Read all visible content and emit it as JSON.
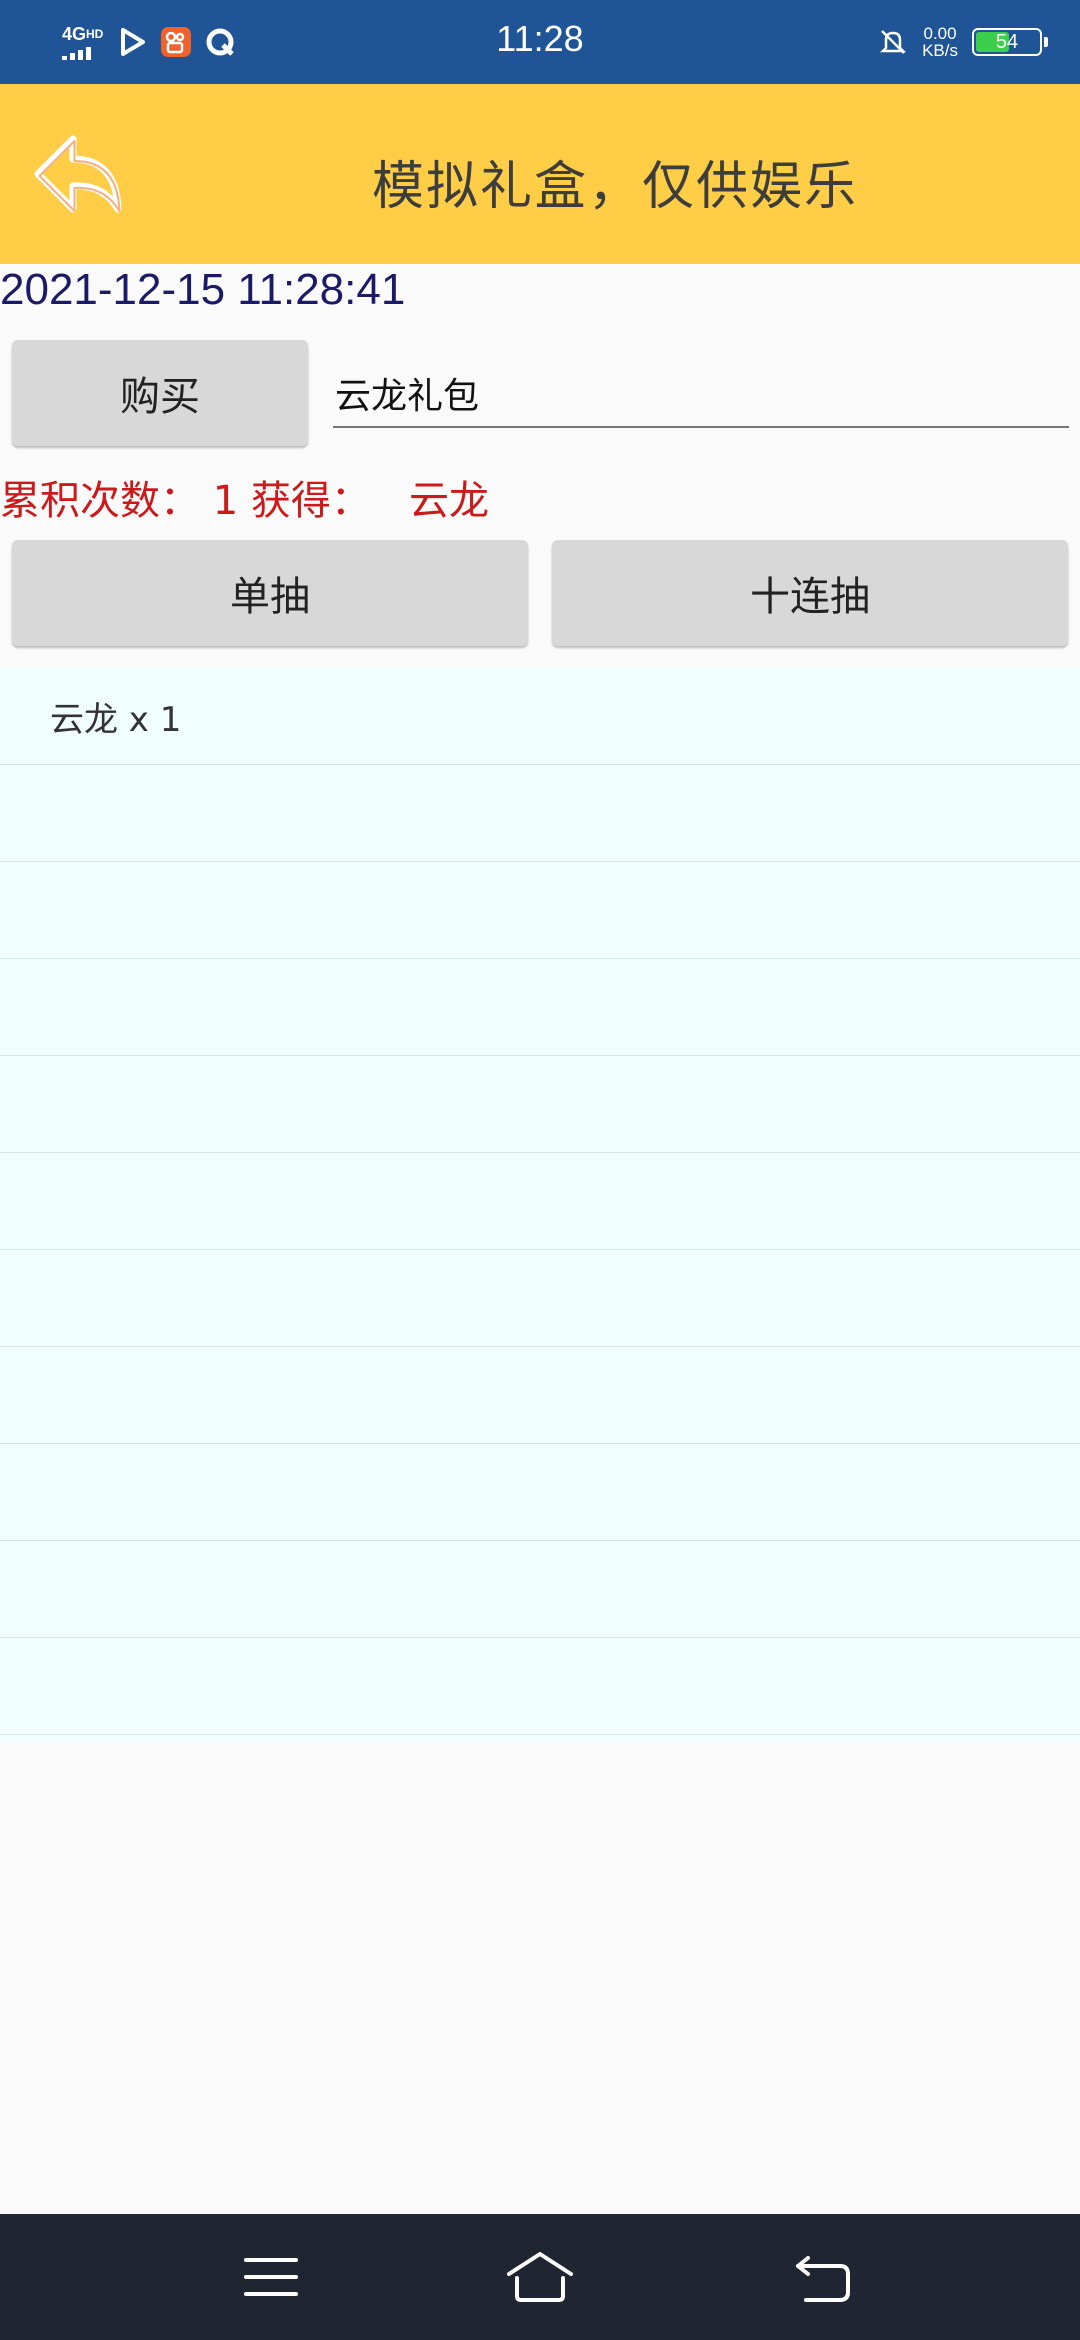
{
  "status_bar": {
    "time": "11:28",
    "network": "4G",
    "network_sup": "HD",
    "net_speed_value": "0.00",
    "net_speed_unit": "KB/s",
    "battery_level": "54",
    "battery_fraction": 0.54,
    "icons": [
      "signal-icon",
      "play-icon",
      "kuaishou-app-icon",
      "q-app-icon",
      "bell-muted-icon",
      "battery-icon"
    ]
  },
  "header": {
    "title": "模拟礼盒，仅供娱乐",
    "back_icon": "back-arrow-icon",
    "accent": "#ffcd46"
  },
  "datetime": "2021-12-15 11:28:41",
  "purchase": {
    "buy_label": "购买",
    "gift_name": "云龙礼包"
  },
  "stats_text": "累积次数： 1 获得：   云龙",
  "draw": {
    "single_label": "单抽",
    "ten_label": "十连抽"
  },
  "results": [
    "云龙 x 1",
    "",
    "",
    "",
    "",
    "",
    "",
    "",
    "",
    "",
    ""
  ],
  "nav": {
    "icons": [
      "menu-icon",
      "home-icon",
      "back-icon"
    ]
  }
}
